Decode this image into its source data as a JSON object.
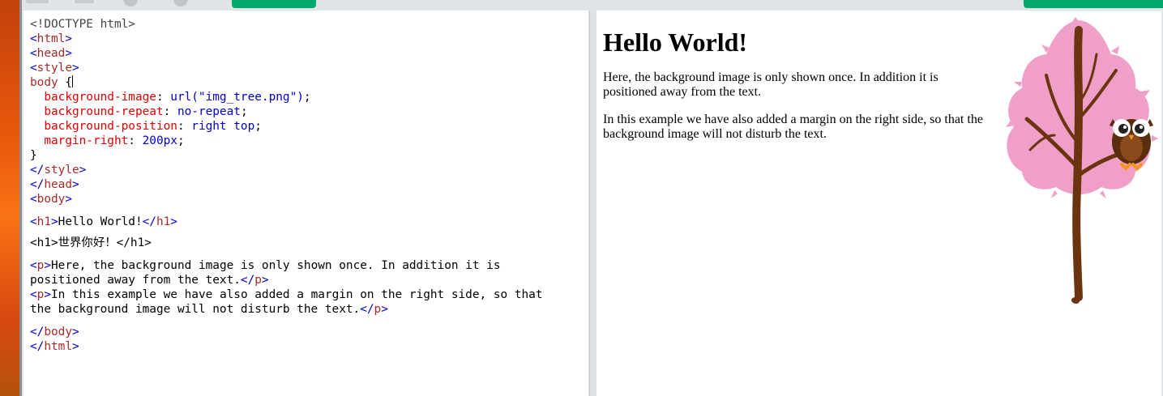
{
  "toolbar": {
    "run_button_color": "#04aa6d"
  },
  "editor": {
    "lines": {
      "doctype": "<!DOCTYPE html>",
      "html_open": "<html>",
      "head_open": "<head>",
      "style_open": "<style>",
      "body_sel": "body ",
      "brace_open": "{",
      "p1_name": "background-image",
      "p1_val": "url(\"img_tree.png\")",
      "p2_name": "background-repeat",
      "p2_val": "no-repeat",
      "p3_name": "background-position",
      "p3_val": "right top",
      "p4_name": "margin-right",
      "p4_val": "200px",
      "brace_close": "}",
      "style_close": "</style>",
      "head_close": "</head>",
      "body_open": "<body>",
      "h1_text": "Hello World!",
      "h1_cn_line": "<h1>世界你好！</h1>",
      "p1_line1": "Here, the background image is only shown once. In addition it is",
      "p1_line2": "positioned away from the text.",
      "p2_line1": "In this example we have also added a margin on the right side, so that",
      "p2_line2": "the background image will not disturb the text.",
      "body_close": "</body>",
      "html_close": "</html>"
    }
  },
  "result": {
    "heading": "Hello World!",
    "paragraph1": "Here, the background image is only shown once. In addition it is positioned away from the text.",
    "paragraph2": "In this example we have also added a margin on the right side, so that the background image will not disturb the text.",
    "image": {
      "icon": "tree-with-owl",
      "foliage_color": "#f0a0c8",
      "trunk_color": "#6b3410"
    }
  }
}
